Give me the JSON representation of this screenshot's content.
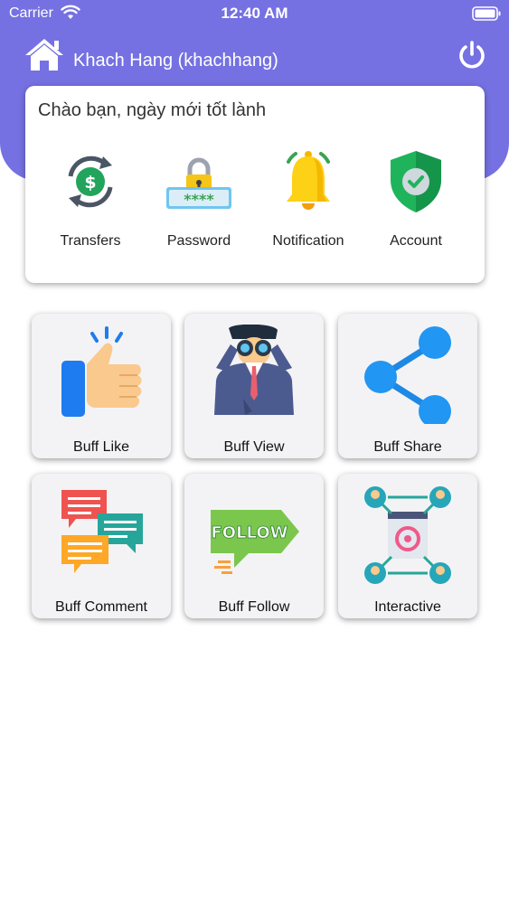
{
  "status_bar": {
    "carrier": "Carrier",
    "time": "12:40 AM"
  },
  "header": {
    "user_name": "Khach Hang (khachhang)",
    "home_icon": "home-icon",
    "power_icon": "power-icon",
    "background_color": "#7571e2"
  },
  "welcome": {
    "greeting": "Chào bạn, ngày mới tốt lành",
    "items": [
      {
        "label": "Transfers",
        "icon": "transfer-money-icon"
      },
      {
        "label": "Password",
        "icon": "password-lock-icon"
      },
      {
        "label": "Notification",
        "icon": "bell-icon"
      },
      {
        "label": "Account",
        "icon": "shield-check-icon"
      }
    ]
  },
  "tiles": [
    {
      "label": "Buff Like",
      "icon": "thumbs-up-icon"
    },
    {
      "label": "Buff View",
      "icon": "binoculars-man-icon"
    },
    {
      "label": "Buff Share",
      "icon": "share-icon"
    },
    {
      "label": "Buff Comment",
      "icon": "chat-bubbles-icon"
    },
    {
      "label": "Buff Follow",
      "icon": "follow-sign-icon"
    },
    {
      "label": "Interactive",
      "icon": "network-icon"
    }
  ],
  "tile_sign_text": "FOLLOW"
}
